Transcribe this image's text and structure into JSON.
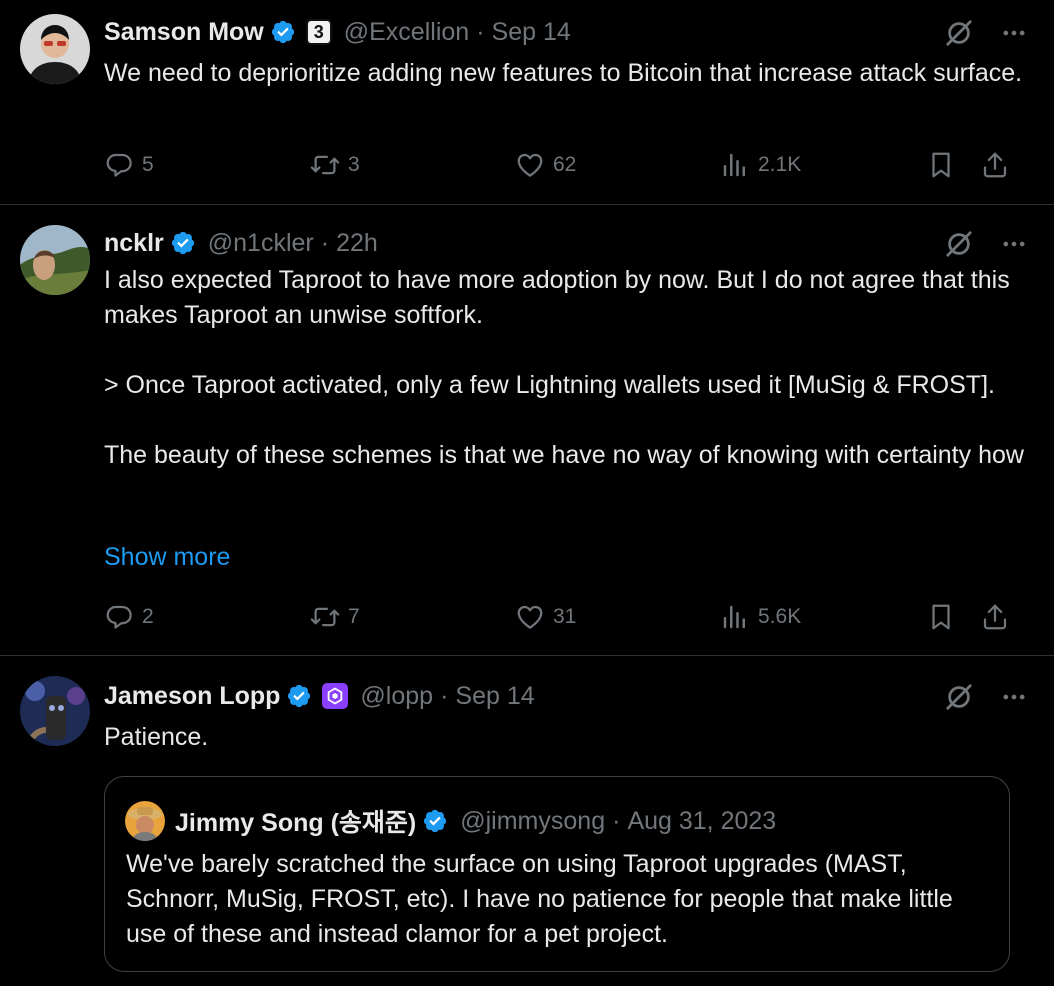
{
  "tweets": [
    {
      "author": "Samson Mow",
      "handle": "@Excellion",
      "time": "Sep 14",
      "badge_text": "3",
      "text": "We need to deprioritize adding new features to Bitcoin that increase attack surface.",
      "replies": "5",
      "reposts": "3",
      "likes": "62",
      "views": "2.1K"
    },
    {
      "author": "ncklr",
      "handle": "@n1ckler",
      "time": "22h",
      "text": "I also expected Taproot to have more adoption by now. But I do not agree that this makes Taproot an unwise softfork.\n\n> Once Taproot activated, only a few Lightning wallets used it [MuSig & FROST].\n\nThe beauty of these schemes is that we have no way of knowing with certainty how",
      "show_more": "Show more",
      "replies": "2",
      "reposts": "7",
      "likes": "31",
      "views": "5.6K"
    },
    {
      "author": "Jameson Lopp",
      "handle": "@lopp",
      "time": "Sep 14",
      "text": "Patience.",
      "quote": {
        "author": "Jimmy Song (송재준)",
        "handle": "@jimmysong",
        "time": "Aug 31, 2023",
        "text": "We've barely scratched the surface on using Taproot upgrades (MAST, Schnorr, MuSig, FROST, etc). I have no patience for people that make little use of these and instead clamor for a pet project."
      }
    }
  ],
  "separator": "·",
  "colors": {
    "background": "#000000",
    "text": "#e7e9ea",
    "muted": "#71767b",
    "accent": "#1d9bf0",
    "border": "#2f3336"
  }
}
